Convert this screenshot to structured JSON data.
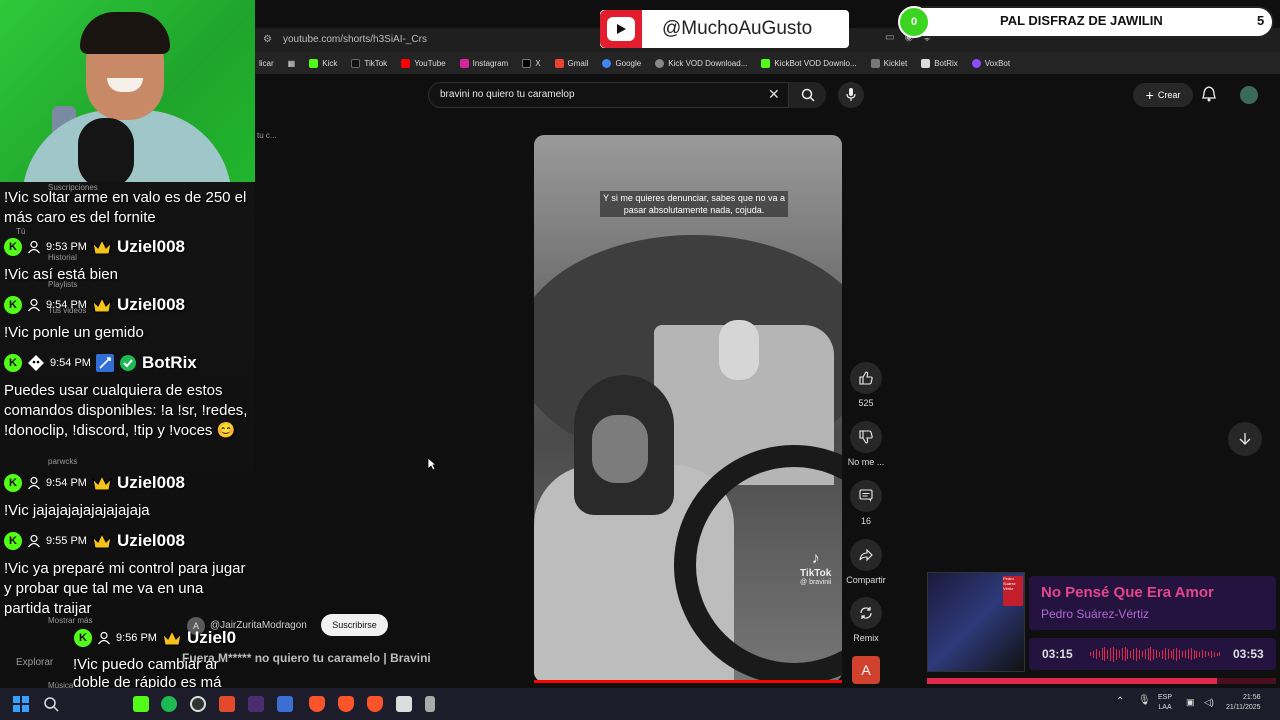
{
  "browser": {
    "url": "youtube.com/shorts/h3SiAI-_Crs",
    "bookmarks": [
      "licar",
      "Kick",
      "TikTok",
      "YouTube",
      "Instagram",
      "X",
      "Gmail",
      "Google",
      "Kick VOD Download...",
      "KickBot VOD Downlo...",
      "Kicklet",
      "BotRix",
      "VoxBot"
    ]
  },
  "youtube": {
    "search_value": "bravini no quiero tu caramelop",
    "create_label": "Crear",
    "sidebar_fragment": "tu c...",
    "caption": "Y si me quieres denunciar, sabes que no va a pasar absolutamente nada, cojuda.",
    "watermark": "TikTok",
    "watermark_handle": "@ bravinii",
    "actions": {
      "like_count": "525",
      "dislike_label": "No me ...",
      "comments_count": "16",
      "share_label": "Compartir",
      "remix_label": "Remix"
    },
    "remix_avatar_letter": "A",
    "channel_avatar_letter": "A",
    "channel_name": "@JairZuritaModragon",
    "subscribe_label": "Suscribirse",
    "video_title": "Fuera M***** no quiero tu caramelo | Bravini"
  },
  "sidebar_ghosts": {
    "suscripciones": "Suscripciones",
    "tu": "Tú",
    "historial": "Historial",
    "playlists": "Playlists",
    "tus_videos": "Tus videos",
    "parwcks": "parwcks",
    "mostrar_mas": "Mostrar más",
    "explorar": "Explorar",
    "musica": "Música"
  },
  "chat": {
    "messages": [
      {
        "text": "!Vic soltar arme en valo es de 250 el más caro es del fornite"
      },
      {
        "time": "9:53 PM",
        "user": "Uziel008",
        "text": "!Vic así está bien"
      },
      {
        "time": "9:54 PM",
        "user": "Uziel008",
        "text": "!Vic ponle un gemido"
      },
      {
        "time": "9:54 PM",
        "user": "BotRix",
        "text": "Puedes usar cualquiera de estos comandos disponibles: !a !sr, !redes, !donoclip, !discord, !tip y !voces 😊"
      },
      {
        "time": "9:54 PM",
        "user": "Uziel008",
        "text": "!Vic jajajajajajajajajaja"
      },
      {
        "time": "9:55 PM",
        "user": "Uziel008",
        "text": "!Vic ya preparé mi control para jugar y probar que tal me va en una partida traijar"
      },
      {
        "time": "9:56 PM",
        "user": "Uziel0",
        "text": "!Vic puedo cambiar ar doble de rápido es má comodo"
      }
    ]
  },
  "overlay": {
    "yt_handle": "@MuchoAuGusto",
    "goal_current": "0",
    "goal_text": "PAL DISFRAZ DE JAWILIN",
    "goal_target": "5"
  },
  "music": {
    "song": "No Pensé Que Era Amor",
    "artist": "Pedro Suárez-Vértiz",
    "time_current": "03:15",
    "time_total": "03:53",
    "progress": 0.83,
    "album_badge": "Pedro Suárez Vértiz"
  },
  "taskbar": {
    "lang_top": "ESP",
    "lang_bottom": "LAA",
    "time": "21:56",
    "date": "21/11/2025"
  },
  "colors": {
    "kick_green": "#53fc18",
    "yt_red": "#e11d2e",
    "song_pink": "#e4468b",
    "crown_gold": "#f4c21a"
  }
}
